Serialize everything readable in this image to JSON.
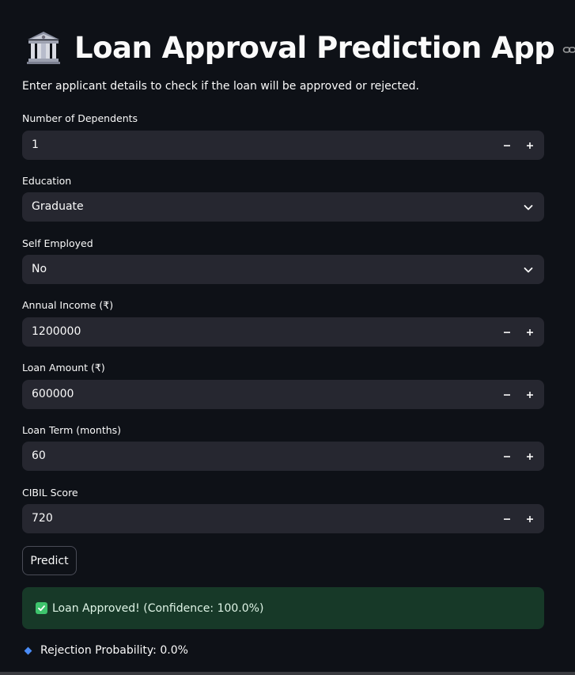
{
  "header": {
    "title": "Loan Approval Prediction App",
    "title_icon": "bank-icon",
    "link_icon": "link-icon"
  },
  "subtitle": "Enter applicant details to check if the loan will be approved or rejected.",
  "form": {
    "dependents": {
      "label": "Number of Dependents",
      "value": "1"
    },
    "education": {
      "label": "Education",
      "value": "Graduate"
    },
    "self_employed": {
      "label": "Self Employed",
      "value": "No"
    },
    "annual_income": {
      "label": "Annual Income (₹)",
      "value": "1200000"
    },
    "loan_amount": {
      "label": "Loan Amount (₹)",
      "value": "600000"
    },
    "loan_term": {
      "label": "Loan Term (months)",
      "value": "60"
    },
    "cibil_score": {
      "label": "CIBIL Score",
      "value": "720"
    }
  },
  "predict_button": "Predict",
  "result": {
    "approved_text": "Loan Approved! (Confidence: 100.0%)",
    "rejection_text": "Rejection Probability: 0.0%"
  },
  "colors": {
    "background": "#0e1117",
    "input_bg": "#262730",
    "success_bg": "#173928",
    "success_icon": "#3ec46d",
    "bullet": "#4a8cf7"
  }
}
